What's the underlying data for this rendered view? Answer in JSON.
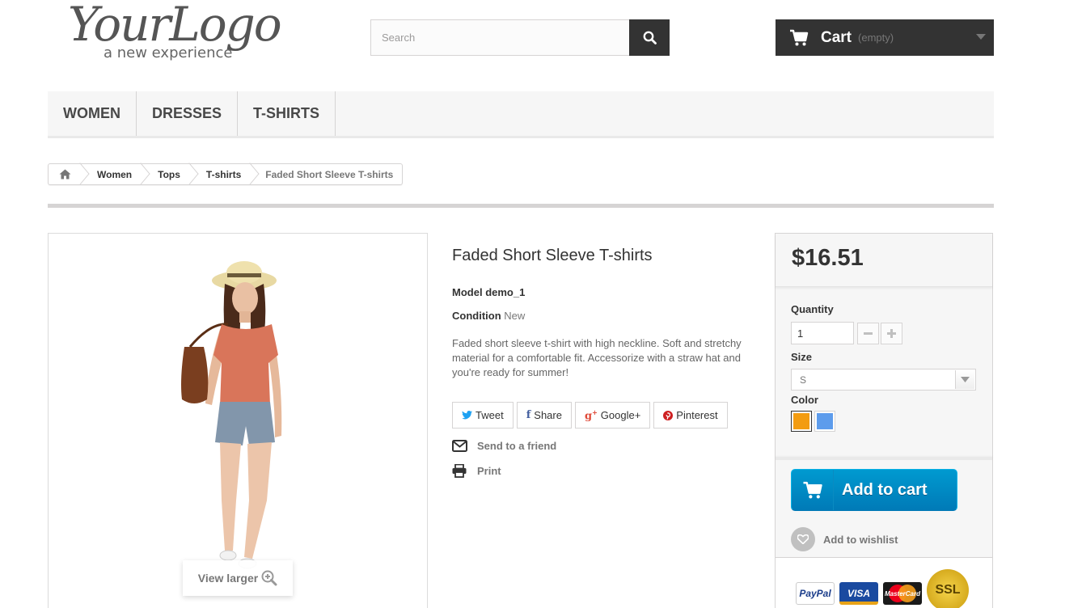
{
  "header": {
    "logo_text": "YourLogo",
    "logo_tagline": "a new experience",
    "search_placeholder": "Search",
    "cart_label": "Cart",
    "cart_status": "(empty)"
  },
  "menu": {
    "items": [
      {
        "label": "WOMEN"
      },
      {
        "label": "DRESSES"
      },
      {
        "label": "T-SHIRTS"
      }
    ]
  },
  "breadcrumb": {
    "items": [
      "Women",
      "Tops",
      "T-shirts"
    ],
    "current": "Faded Short Sleeve T-shirts"
  },
  "product": {
    "title": "Faded Short Sleeve T-shirts",
    "model_label": "Model",
    "model_value": "demo_1",
    "condition_label": "Condition",
    "condition_value": "New",
    "description": "Faded short sleeve t-shirt with high neckline. Soft and stretchy material for a comfortable fit. Accessorize with a straw hat and you're ready for summer!",
    "view_larger": "View larger"
  },
  "social": {
    "tweet": "Tweet",
    "share": "Share",
    "google": "Google+",
    "pinterest": "Pinterest"
  },
  "actions": {
    "send_to_friend": "Send to a friend",
    "print": "Print"
  },
  "buy": {
    "price": "$16.51",
    "quantity_label": "Quantity",
    "quantity_value": "1",
    "size_label": "Size",
    "size_value": "S",
    "color_label": "Color",
    "colors": [
      "#f39c11",
      "#5d9cec"
    ],
    "add_to_cart": "Add to cart",
    "add_to_wishlist": "Add to wishlist",
    "payment_logos": [
      "PayPal",
      "VISA",
      "MasterCard",
      "SSL"
    ]
  },
  "colors": {
    "dark": "#333333",
    "accent_blue": "#009ad0",
    "nav_bg": "#f6f6f6"
  }
}
